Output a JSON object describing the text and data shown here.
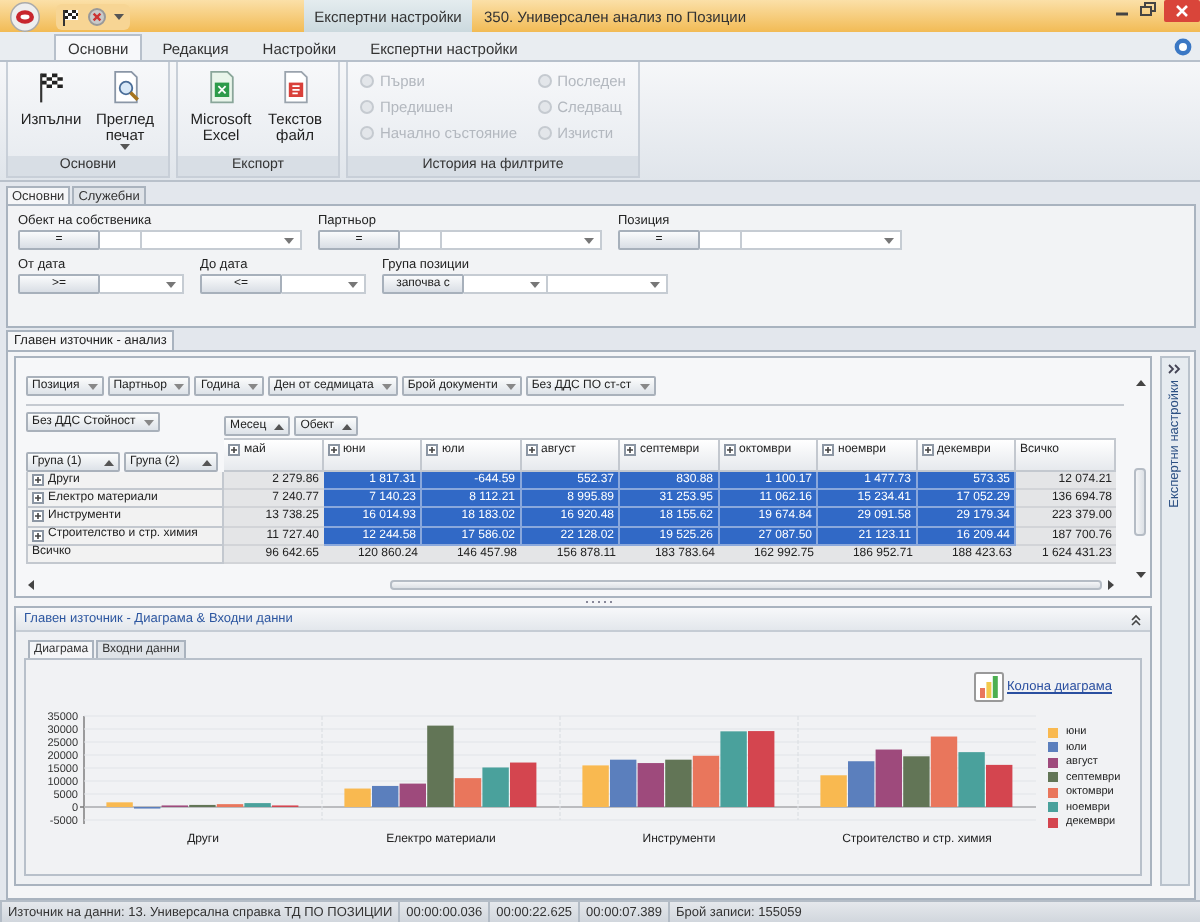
{
  "window": {
    "title": "350. Универсален анализ по Позиции",
    "context_tab": "Експертни настройки"
  },
  "ribbon": {
    "tabs": [
      {
        "label": "Основни",
        "selected": true
      },
      {
        "label": "Редакция",
        "selected": false
      },
      {
        "label": "Настройки",
        "selected": false
      },
      {
        "label": "Експертни настройки",
        "selected": false
      }
    ],
    "groups": [
      {
        "label": "Основни",
        "items": [
          {
            "kind": "large",
            "label": "Изпълни"
          },
          {
            "kind": "large_menu",
            "label": "Преглед печат"
          }
        ]
      },
      {
        "label": "Експорт",
        "items": [
          {
            "kind": "large",
            "label": "Microsoft Excel"
          },
          {
            "kind": "large",
            "label": "Текстов файл"
          }
        ]
      },
      {
        "label": "История на филтрите",
        "items": [
          {
            "kind": "small",
            "label": "Първи",
            "disabled": true
          },
          {
            "kind": "small",
            "label": "Предишен",
            "disabled": true
          },
          {
            "kind": "small",
            "label": "Начално състояние",
            "disabled": true
          },
          {
            "kind": "small",
            "label": "Последен",
            "disabled": true
          },
          {
            "kind": "small",
            "label": "Следващ",
            "disabled": true
          },
          {
            "kind": "small",
            "label": "Изчисти",
            "disabled": true
          }
        ]
      }
    ]
  },
  "filter_tabs": [
    {
      "label": "Основни",
      "selected": true
    },
    {
      "label": "Служебни",
      "selected": false
    }
  ],
  "filters": [
    [
      {
        "label": "Обект на собственика",
        "operator": "=",
        "inputs": [
          {
            "kind": "text"
          },
          {
            "kind": "combo"
          }
        ]
      },
      {
        "label": "Партньор",
        "operator": "=",
        "inputs": [
          {
            "kind": "text"
          },
          {
            "kind": "combo"
          }
        ]
      },
      {
        "label": "Позиция",
        "operator": "=",
        "inputs": [
          {
            "kind": "text"
          },
          {
            "kind": "combo"
          }
        ]
      }
    ],
    [
      {
        "label": "От дата",
        "operator": ">=",
        "inputs": [
          {
            "kind": "short_combo"
          }
        ]
      },
      {
        "label": "До дата",
        "operator": "<=",
        "inputs": [
          {
            "kind": "short_combo"
          }
        ]
      },
      {
        "label": "Група позиции",
        "operator": "започва с",
        "inputs": [
          {
            "kind": "short_combo"
          },
          {
            "kind": "wide_combo"
          }
        ]
      }
    ]
  ],
  "main_tab": {
    "label": "Главен източник - анализ"
  },
  "side_panel": {
    "label": "Експертни настройки"
  },
  "pivot": {
    "filter_fields": [
      "Позиция",
      "Партньор",
      "Година",
      "Ден от седмицата",
      "Брой документи",
      "Без ДДС ПО ст-ст"
    ],
    "data_field": "Без ДДС Стойност",
    "column_fields": [
      "Месец",
      "Обект"
    ],
    "row_fields": [
      "Група (1)",
      "Група (2)"
    ],
    "columns": [
      {
        "label": "май",
        "expandable": true,
        "selected": false
      },
      {
        "label": "юни",
        "expandable": true,
        "selected": true
      },
      {
        "label": "юли",
        "expandable": true,
        "selected": true
      },
      {
        "label": "август",
        "expandable": true,
        "selected": true
      },
      {
        "label": "септември",
        "expandable": true,
        "selected": true
      },
      {
        "label": "октомври",
        "expandable": true,
        "selected": true
      },
      {
        "label": "ноември",
        "expandable": true,
        "selected": true
      },
      {
        "label": "декември",
        "expandable": true,
        "selected": true
      },
      {
        "label": "Всичко",
        "expandable": false,
        "selected": false
      }
    ],
    "rows": [
      {
        "label": "Други",
        "expandable": true,
        "selected": true,
        "cells": [
          "2 279.86",
          "1 817.31",
          "-644.59",
          "552.37",
          "830.88",
          "1 100.17",
          "1 477.73",
          "573.35",
          "12 074.21"
        ]
      },
      {
        "label": "Електро материали",
        "expandable": true,
        "selected": true,
        "cells": [
          "7 240.77",
          "7 140.23",
          "8 112.21",
          "8 995.89",
          "31 253.95",
          "11 062.16",
          "15 234.41",
          "17 052.29",
          "136 694.78"
        ]
      },
      {
        "label": "Инструменти",
        "expandable": true,
        "selected": true,
        "cells": [
          "13 738.25",
          "16 014.93",
          "18 183.02",
          "16 920.48",
          "18 155.62",
          "19 674.84",
          "29 091.58",
          "29 179.34",
          "223 379.00"
        ]
      },
      {
        "label": "Строителство и стр. химия",
        "expandable": true,
        "selected": true,
        "cells": [
          "11 727.40",
          "12 244.58",
          "17 586.02",
          "22 128.02",
          "19 525.26",
          "27 087.50",
          "21 123.11",
          "16 209.44",
          "187 700.76"
        ]
      },
      {
        "label": "Всичко",
        "expandable": false,
        "selected": false,
        "cells": [
          "96 642.65",
          "120 860.24",
          "146 457.98",
          "156 878.11",
          "183 783.64",
          "162 992.75",
          "186 952.71",
          "188 423.63",
          "1 624 431.23"
        ]
      }
    ]
  },
  "chart_panel": {
    "title": "Главен източник - Диаграма & Входни данни",
    "tabs": [
      {
        "label": "Диаграма",
        "selected": true
      },
      {
        "label": "Входни данни",
        "selected": false
      }
    ],
    "link": "Колона диаграма",
    "chart_data": {
      "type": "bar",
      "categories": [
        "Други",
        "Електро материали",
        "Инструменти",
        "Строителство и стр. химия"
      ],
      "series": [
        {
          "name": "юни",
          "color": "#f9b950",
          "values": [
            1800,
            7100,
            16000,
            12200
          ]
        },
        {
          "name": "юли",
          "color": "#5b7fbd",
          "values": [
            -600,
            8100,
            18200,
            17600
          ]
        },
        {
          "name": "август",
          "color": "#9e4a7c",
          "values": [
            600,
            9000,
            16900,
            22100
          ]
        },
        {
          "name": "септември",
          "color": "#627556",
          "values": [
            800,
            31300,
            18200,
            19500
          ]
        },
        {
          "name": "октомври",
          "color": "#e9765c",
          "values": [
            1100,
            11100,
            19700,
            27100
          ]
        },
        {
          "name": "ноември",
          "color": "#4aa19c",
          "values": [
            1500,
            15200,
            29100,
            21100
          ]
        },
        {
          "name": "декември",
          "color": "#d4454f",
          "values": [
            600,
            17100,
            29200,
            16200
          ]
        }
      ],
      "ylim": [
        -5000,
        35000
      ],
      "yticks": [
        -5000,
        0,
        5000,
        10000,
        15000,
        20000,
        25000,
        30000,
        35000
      ],
      "grid": true,
      "legend": true
    }
  },
  "status_bar": {
    "items": [
      "Източник на данни: 13. Универсална справка ТД ПО ПОЗИЦИИ",
      "00:00:00.036",
      "00:00:22.625",
      "00:00:07.389",
      "Брой записи: 155059"
    ]
  }
}
